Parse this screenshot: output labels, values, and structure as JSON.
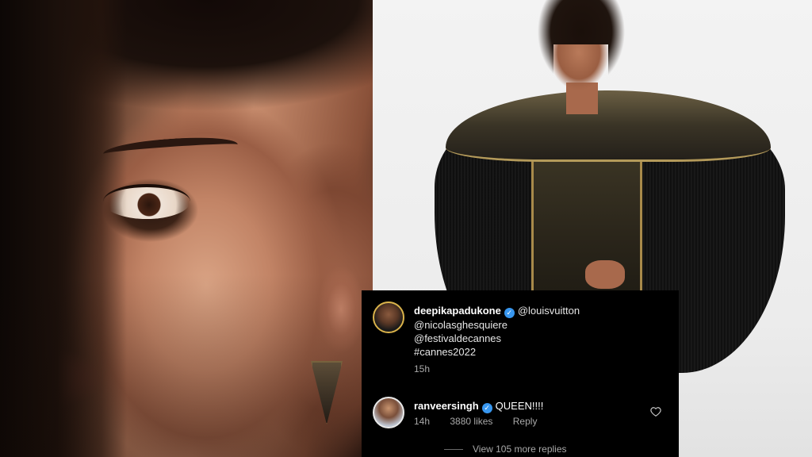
{
  "post": {
    "author": "deepikapadukone",
    "caption_lines": [
      "@louisvuitton",
      "@nicolasghesquiere",
      "@festivaldecannes",
      "#cannes2022"
    ],
    "time": "15h",
    "avatar_icon": "profile-avatar-with-story-ring"
  },
  "comment": {
    "author": "ranveersingh",
    "text": "QUEEN!!!!",
    "time": "14h",
    "likes": "3880 likes",
    "reply_label": "Reply",
    "like_icon": "heart-outline-icon"
  },
  "view_more_replies": "View 105 more replies",
  "colors": {
    "panel_bg": "#000000",
    "verified_badge": "#3897f0",
    "secondary_text": "#a8a8a8",
    "story_ring": "#d9b24a"
  }
}
